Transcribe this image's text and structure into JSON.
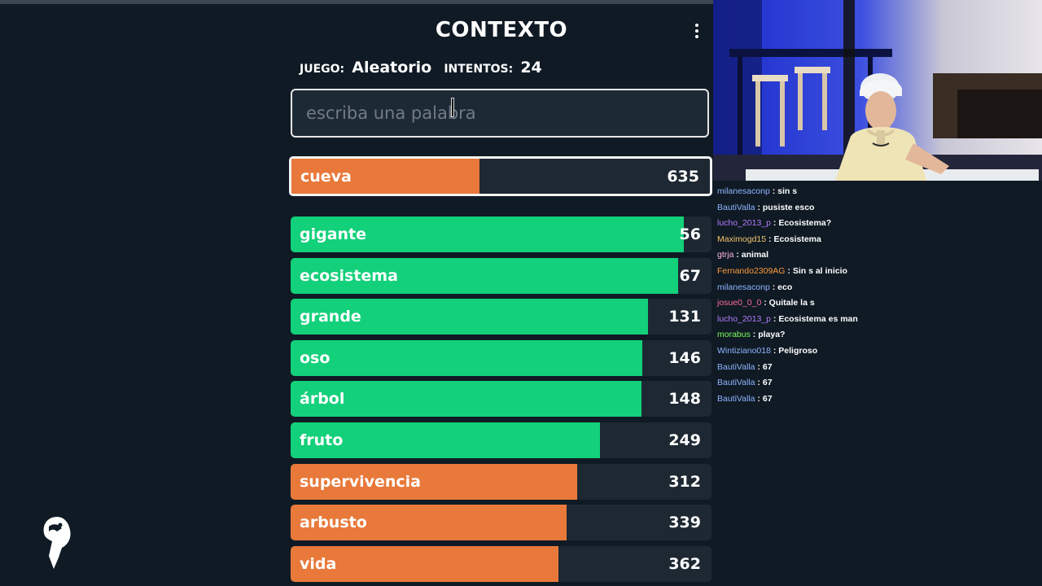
{
  "game": {
    "title": "CONTEXTO",
    "juego_label": "JUEGO:",
    "juego_value": "Aleatorio",
    "intentos_label": "INTENTOS:",
    "intentos_value": "24",
    "input_placeholder": "escriba una palabra",
    "current_guess": {
      "word": "cueva",
      "rank": "635",
      "color": "#e8793a",
      "fill": 0.45
    },
    "guesses": [
      {
        "word": "gigante",
        "rank": "56",
        "color": "#13d07a",
        "fill": 0.935
      },
      {
        "word": "ecosistema",
        "rank": "67",
        "color": "#13d07a",
        "fill": 0.92
      },
      {
        "word": "grande",
        "rank": "131",
        "color": "#13d07a",
        "fill": 0.85
      },
      {
        "word": "oso",
        "rank": "146",
        "color": "#13d07a",
        "fill": 0.835
      },
      {
        "word": "árbol",
        "rank": "148",
        "color": "#13d07a",
        "fill": 0.833
      },
      {
        "word": "fruto",
        "rank": "249",
        "color": "#13d07a",
        "fill": 0.735
      },
      {
        "word": "supervivencia",
        "rank": "312",
        "color": "#e8793a",
        "fill": 0.68
      },
      {
        "word": "arbusto",
        "rank": "339",
        "color": "#e8793a",
        "fill": 0.655
      },
      {
        "word": "vida",
        "rank": "362",
        "color": "#e8793a",
        "fill": 0.637
      }
    ]
  },
  "chat": [
    {
      "user": "milanesaconp",
      "color": "#8fb4ff",
      "msg": "sin s"
    },
    {
      "user": "BautiValla",
      "color": "#8fb4ff",
      "msg": "pusiste esco"
    },
    {
      "user": "lucho_2013_p",
      "color": "#b57cff",
      "msg": "Ecosistema?"
    },
    {
      "user": "Maximogd15",
      "color": "#f2c46b",
      "msg": "Ecosistema"
    },
    {
      "user": "gtrja",
      "color": "#ffb7e0",
      "msg": "animal"
    },
    {
      "user": "Fernando2309AG",
      "color": "#ff9a3c",
      "msg": "Sin s al inicio"
    },
    {
      "user": "milanesaconp",
      "color": "#8fb4ff",
      "msg": "eco"
    },
    {
      "user": "josue0_0_0",
      "color": "#ff6b9a",
      "msg": "Quitale la s"
    },
    {
      "user": "lucho_2013_p",
      "color": "#b57cff",
      "msg": "Ecosistema es man"
    },
    {
      "user": "morabus",
      "color": "#7cff5a",
      "msg": "playa?"
    },
    {
      "user": "Wintiziano018",
      "color": "#8fb4ff",
      "msg": "Peligroso"
    },
    {
      "user": "BautiValla",
      "color": "#8fb4ff",
      "msg": "67"
    },
    {
      "user": "BautiValla",
      "color": "#8fb4ff",
      "msg": "67"
    },
    {
      "user": "BautiValla",
      "color": "#8fb4ff",
      "msg": "67"
    }
  ]
}
